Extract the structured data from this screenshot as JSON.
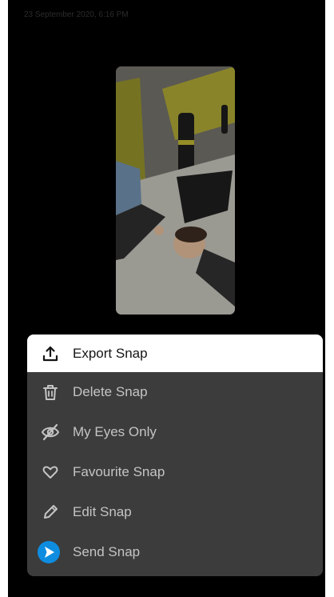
{
  "header": {
    "timestamp": "23 September 2020, 6:16 PM"
  },
  "snap": {
    "thumbnail_icon": "photo-thumbnail"
  },
  "menu": {
    "items": [
      {
        "label": "Export Snap",
        "icon": "export-icon"
      },
      {
        "label": "Delete Snap",
        "icon": "trash-icon"
      },
      {
        "label": "My Eyes Only",
        "icon": "eye-off-icon"
      },
      {
        "label": "Favourite Snap",
        "icon": "heart-icon"
      },
      {
        "label": "Edit Snap",
        "icon": "pencil-icon"
      },
      {
        "label": "Send Snap",
        "icon": "send-icon"
      }
    ]
  },
  "colors": {
    "background": "#000000",
    "sheet": "#3c3c3c",
    "highlight": "#ffffff",
    "send_accent": "#0e8de0",
    "label_dim": "#c4c4c4"
  }
}
